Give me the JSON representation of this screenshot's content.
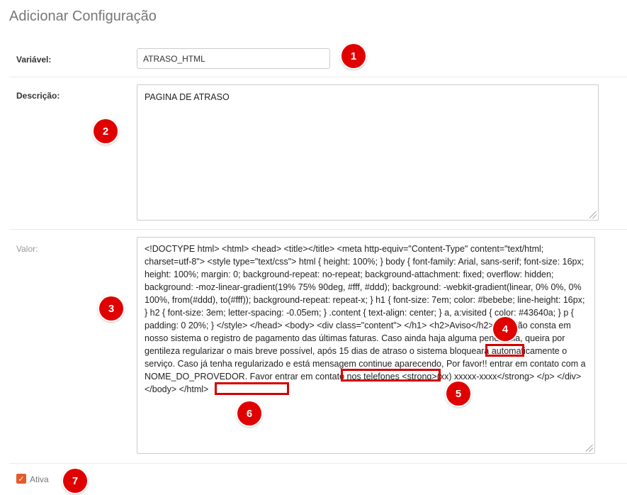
{
  "page": {
    "title": "Adicionar Configuração"
  },
  "form": {
    "variavel": {
      "label": "Variável:",
      "value": "ATRASO_HTML"
    },
    "descricao": {
      "label": "Descrição:",
      "value": "PAGINA DE ATRASO"
    },
    "valor": {
      "label": "Valor:",
      "value": "<!DOCTYPE html> <html> <head> <title></title> <meta http-equiv=\"Content-Type\" content=\"text/html; charset=utf-8\"> <style type=\"text/css\"> html { height: 100%; } body { font-family: Arial, sans-serif; font-size: 16px; height: 100%; margin: 0; background-repeat: no-repeat; background-attachment: fixed; overflow: hidden; background: -moz-linear-gradient(19% 75% 90deg, #fff, #ddd); background: -webkit-gradient(linear, 0% 0%, 0% 100%, from(#ddd), to(#fff)); background-repeat: repeat-x; } h1 { font-size: 7em; color: #bebebe; line-height: 16px; } h2 { font-size: 3em; letter-spacing: -0.05em; } .content { text-align: center; } a, a:visited { color: #43640a; } p { padding: 0 20%; } </style> </head> <body> <div class=\"content\"> </h1> <h2>Aviso</h2> <p>Não consta em nosso sistema o registro de pagamento das últimas faturas. Caso ainda haja alguma pendência, queira por gentileza regularizar o mais breve possível, após 15 dias de atraso o sistema bloqueará automaticamente o serviço. Caso já tenha regularizado e está mensagem continue aparecendo, Por favor!! entrar em contato com a NOME_DO_PROVEDOR. Favor entrar em contato nos telefones <strong>(xx) xxxxx-xxxx</strong> </p> </div> </body> </html>"
    },
    "ativa": {
      "label": "Ativa",
      "checked": true
    }
  },
  "annotations": [
    "1",
    "2",
    "3",
    "4",
    "5",
    "6",
    "7"
  ],
  "colors": {
    "badge": "#e00000",
    "highlight": "#d40000",
    "checkbox": "#e55a2b"
  }
}
